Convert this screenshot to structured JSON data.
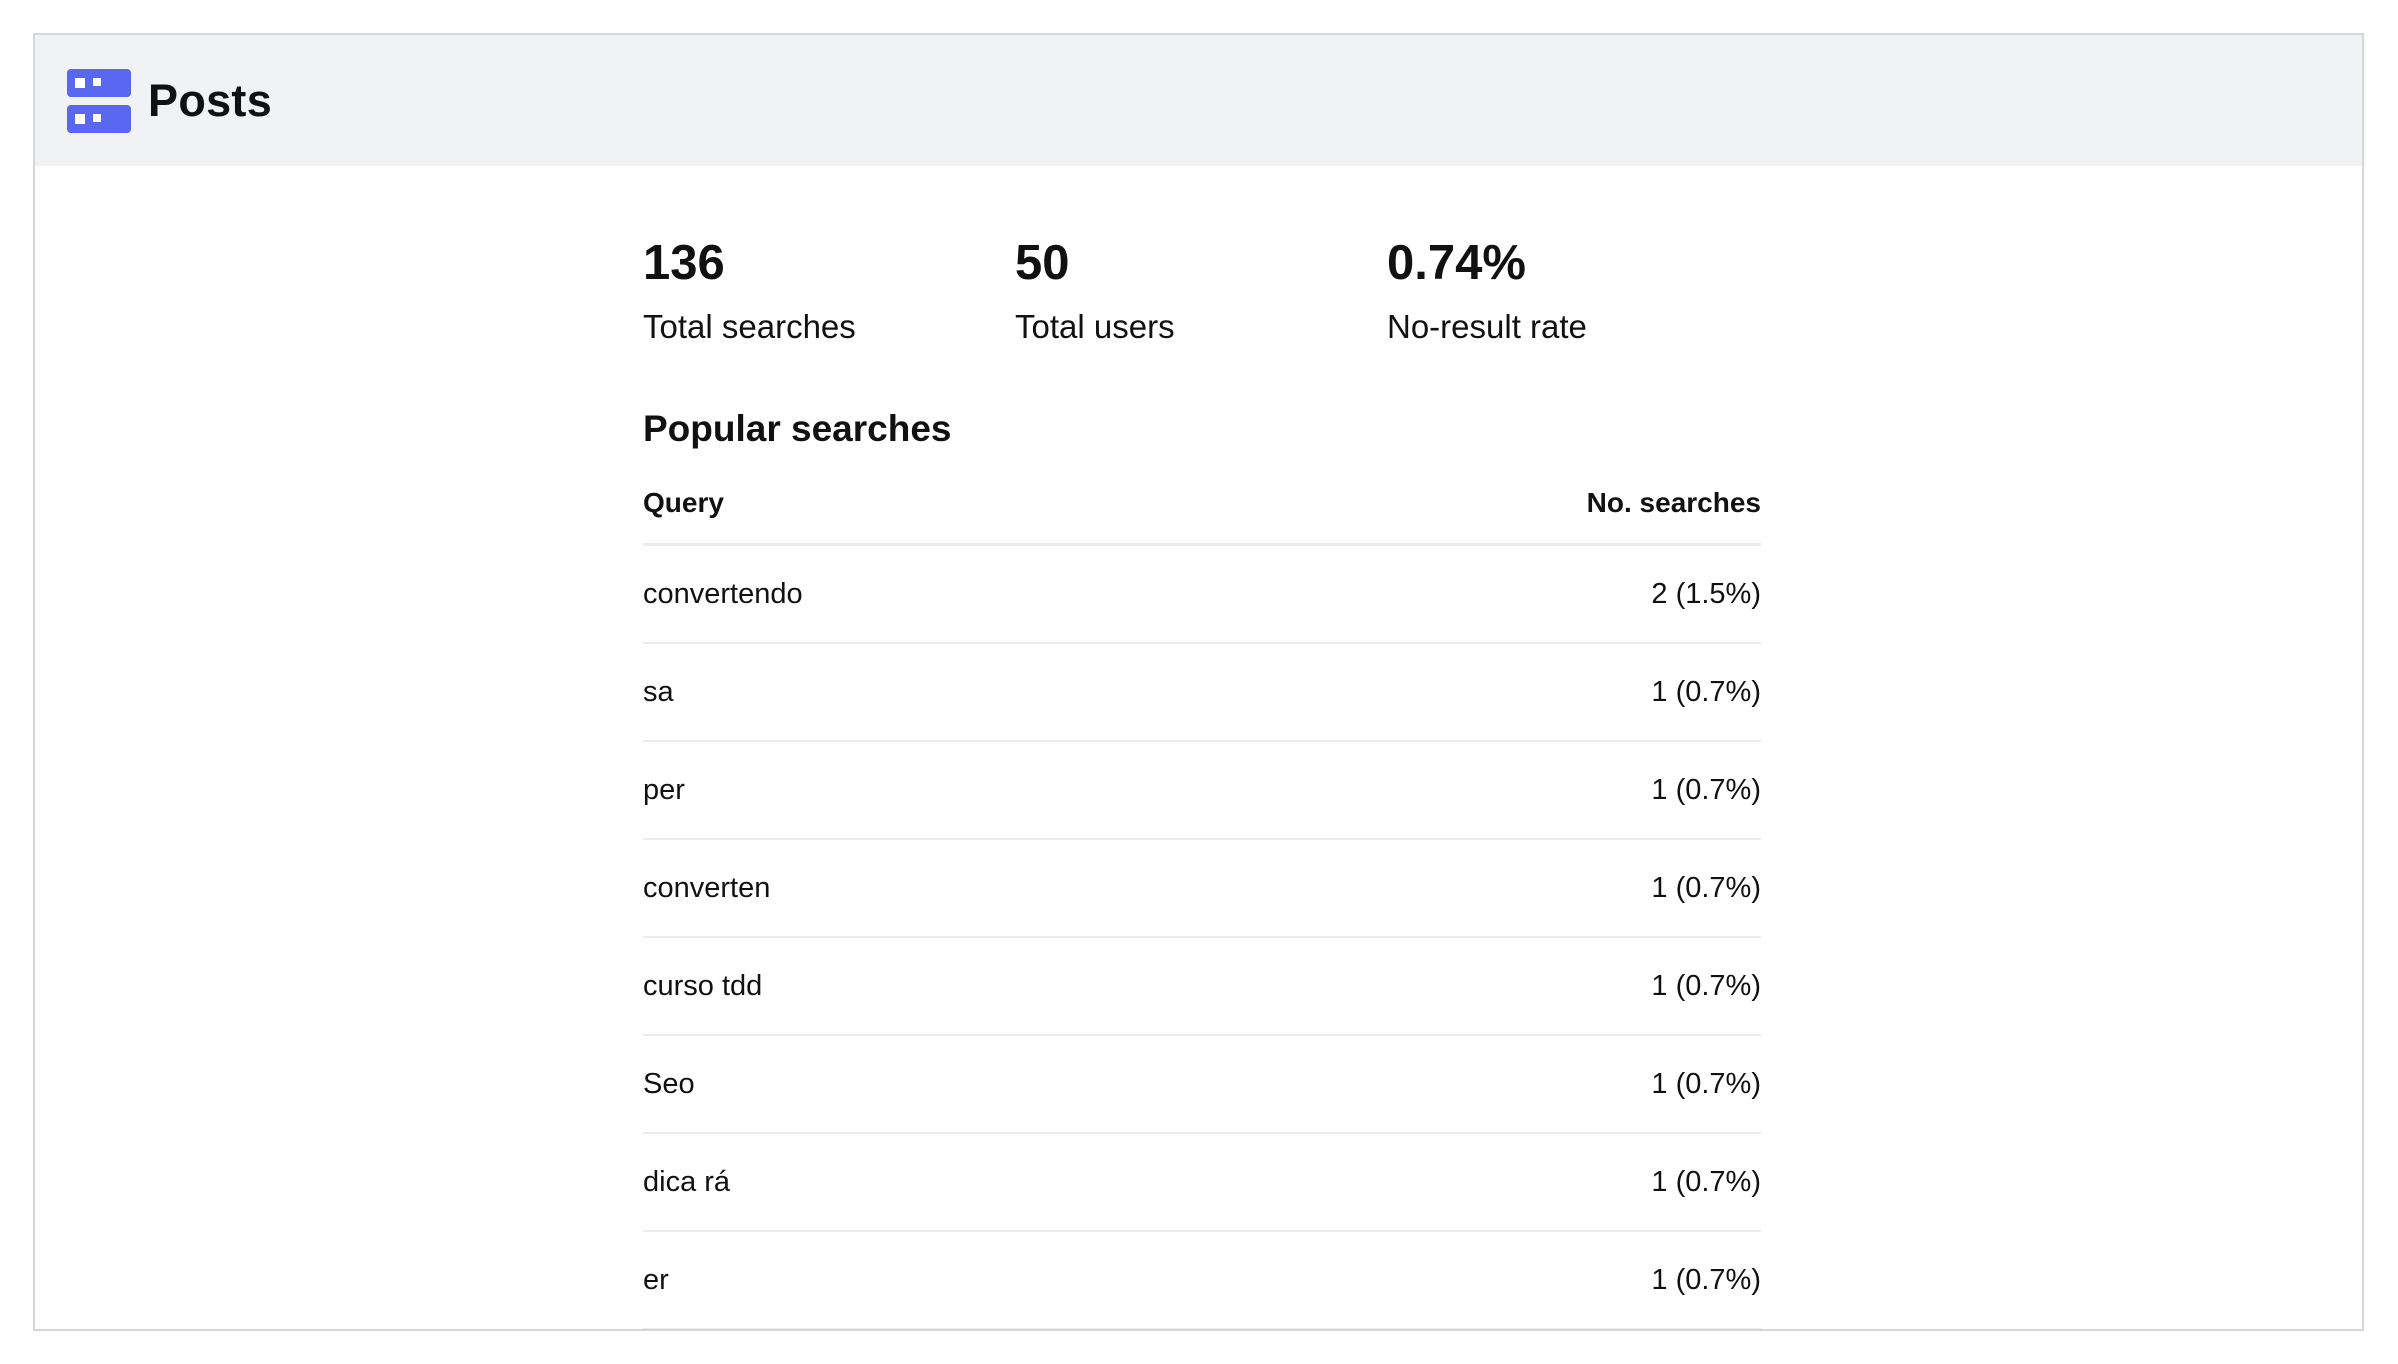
{
  "header": {
    "title": "Posts",
    "icon": "index-icon",
    "icon_color": "#5a67f0"
  },
  "stats": [
    {
      "value": "136",
      "label": "Total searches"
    },
    {
      "value": "50",
      "label": "Total users"
    },
    {
      "value": "0.74%",
      "label": "No-result rate"
    }
  ],
  "popular": {
    "title": "Popular searches",
    "columns": {
      "query": "Query",
      "count": "No. searches"
    },
    "rows": [
      {
        "query": "convertendo",
        "count": "2 (1.5%)"
      },
      {
        "query": "sa",
        "count": "1 (0.7%)"
      },
      {
        "query": "per",
        "count": "1 (0.7%)"
      },
      {
        "query": "converten",
        "count": "1 (0.7%)"
      },
      {
        "query": "curso tdd",
        "count": "1 (0.7%)"
      },
      {
        "query": "Seo",
        "count": "1 (0.7%)"
      },
      {
        "query": "dica rá",
        "count": "1 (0.7%)"
      },
      {
        "query": "er",
        "count": "1 (0.7%)"
      }
    ]
  }
}
